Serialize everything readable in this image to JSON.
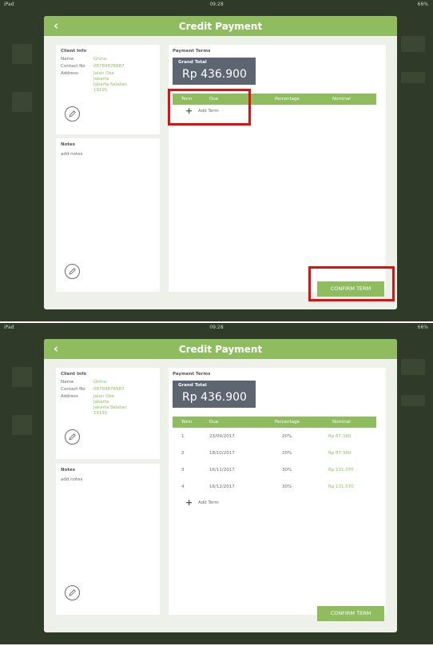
{
  "status": {
    "device": "iPad",
    "time": "09:28",
    "battery": "66%"
  },
  "title": "Credit Payment",
  "back_glyph": "‹",
  "client": {
    "heading": "Client Info",
    "name_label": "Name",
    "name": "Ghina",
    "contact_label": "Contact No",
    "contact": "08789878987",
    "address_label": "Address",
    "address": [
      "Jalan Oke",
      "Jakarta",
      "Jakarta Selatan",
      "19191"
    ]
  },
  "notes": {
    "heading": "Notes",
    "placeholder": "add notes"
  },
  "terms": {
    "heading": "Payment Terms",
    "grand_total_label": "Grand Total",
    "grand_total": "Rp 436.900",
    "columns": [
      "Term",
      "Due",
      "Percentage",
      "Nominal"
    ],
    "rows": [
      {
        "term": "1",
        "due": "23/09/2017",
        "percentage": "20%",
        "nominal": "Rp 87.380"
      },
      {
        "term": "2",
        "due": "18/10/2017",
        "percentage": "20%",
        "nominal": "Rp 87.380"
      },
      {
        "term": "3",
        "due": "16/11/2017",
        "percentage": "30%",
        "nominal": "Rp 131.070"
      },
      {
        "term": "4",
        "due": "16/12/2017",
        "percentage": "30%",
        "nominal": "Rp 131.070"
      }
    ],
    "add_term": "Add Term"
  },
  "confirm_label": "CONFIRM TERM",
  "icons": {
    "edit": "pencil-icon",
    "back": "chevron-left-icon",
    "add": "plus-icon"
  },
  "colors": {
    "accent": "#8fbc5f",
    "grand_total_bg": "#5d6570",
    "highlight": "#e01010"
  }
}
